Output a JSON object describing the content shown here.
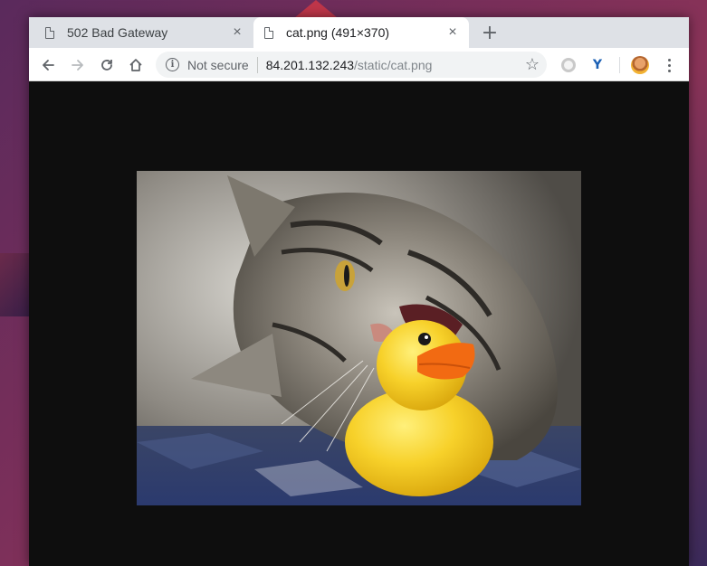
{
  "colors": {
    "desktop_bg": "#7a2f5a",
    "tabstrip_bg": "#dee1e6",
    "viewport_bg": "#0e0e0e",
    "duck_yellow": "#f7d12a",
    "duck_beak": "#f26a12"
  },
  "tabs": [
    {
      "title": "502 Bad Gateway",
      "icon": "document-icon",
      "active": false
    },
    {
      "title": "cat.png (491×370)",
      "icon": "document-icon",
      "active": true
    }
  ],
  "toolbar": {
    "new_tab": "+",
    "tab_close": "×"
  },
  "omnibox": {
    "security_label": "Not secure",
    "url_host": "84.201.132.243",
    "url_path": "/static/cat.png"
  },
  "image": {
    "description_name": "cat.png",
    "natural_width": 491,
    "natural_height": 370
  }
}
